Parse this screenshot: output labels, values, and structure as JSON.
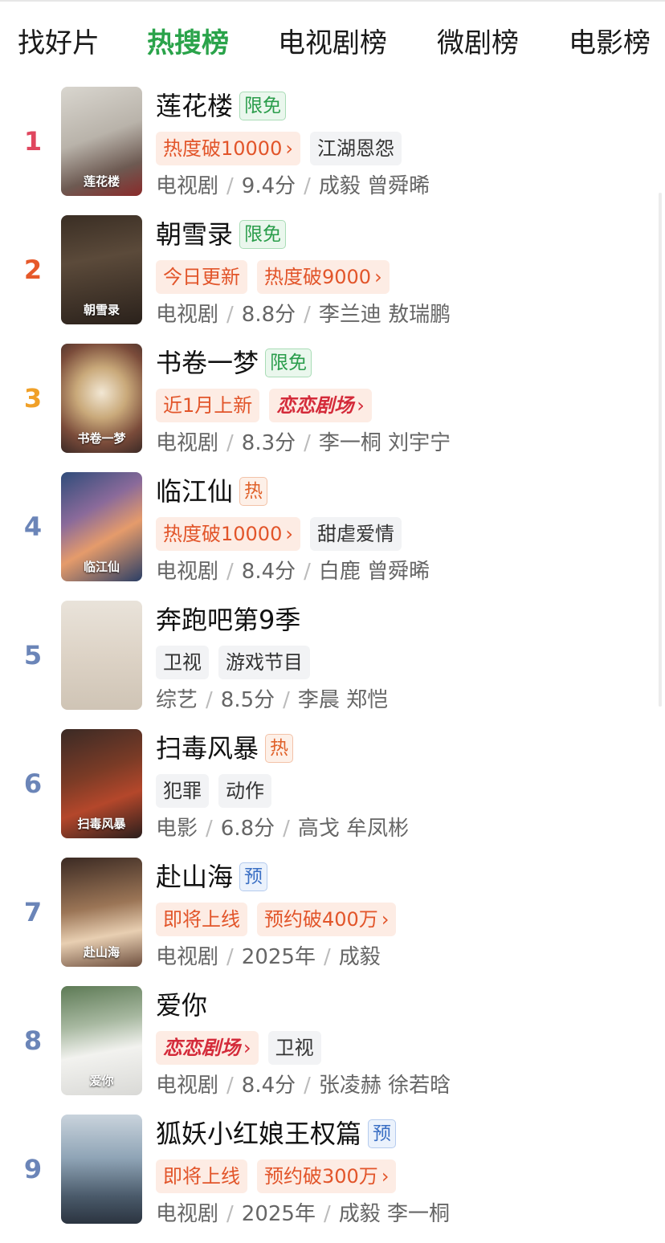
{
  "tabs": [
    {
      "label": "找好片",
      "active": false
    },
    {
      "label": "热搜榜",
      "active": true
    },
    {
      "label": "电视剧榜",
      "active": false
    },
    {
      "label": "微剧榜",
      "active": false
    },
    {
      "label": "电影榜",
      "active": false
    }
  ],
  "colors": {
    "active_tab": "#2aa34a",
    "rank_1": "#e0475f",
    "rank_2": "#e6592a",
    "rank_3": "#f0a028",
    "rank_other": "#6b85b8"
  },
  "items": [
    {
      "rank": "1",
      "title": "莲花楼",
      "badge": "限免",
      "badge_type": "free",
      "tags": [
        {
          "text": "热度破10000",
          "style": "orange",
          "chevron": "›"
        },
        {
          "text": "江湖恩怨",
          "style": "gray"
        }
      ],
      "meta": {
        "type": "电视剧",
        "score": "9.4分",
        "cast": "成毅 曾舜晞"
      },
      "poster": {
        "icon": "poster-image",
        "caption": "莲花楼"
      }
    },
    {
      "rank": "2",
      "title": "朝雪录",
      "badge": "限免",
      "badge_type": "free",
      "tags": [
        {
          "text": "今日更新",
          "style": "orange"
        },
        {
          "text": "热度破9000",
          "style": "orange",
          "chevron": "›"
        }
      ],
      "meta": {
        "type": "电视剧",
        "score": "8.8分",
        "cast": "李兰迪 敖瑞鹏"
      },
      "poster": {
        "icon": "poster-image",
        "caption": "朝雪录"
      }
    },
    {
      "rank": "3",
      "title": "书卷一梦",
      "badge": "限免",
      "badge_type": "free",
      "tags": [
        {
          "text": "近1月上新",
          "style": "orange"
        },
        {
          "text": "恋恋剧场",
          "style": "brand",
          "chevron": "›"
        }
      ],
      "meta": {
        "type": "电视剧",
        "score": "8.3分",
        "cast": "李一桐 刘宇宁"
      },
      "poster": {
        "icon": "poster-image",
        "caption": "书卷一梦"
      }
    },
    {
      "rank": "4",
      "title": "临江仙",
      "badge": "热",
      "badge_type": "hot",
      "tags": [
        {
          "text": "热度破10000",
          "style": "orange",
          "chevron": "›"
        },
        {
          "text": "甜虐爱情",
          "style": "gray"
        }
      ],
      "meta": {
        "type": "电视剧",
        "score": "8.4分",
        "cast": "白鹿 曾舜晞"
      },
      "poster": {
        "icon": "poster-image",
        "caption": "临江仙"
      }
    },
    {
      "rank": "5",
      "title": "奔跑吧第9季",
      "badge": "",
      "badge_type": "",
      "tags": [
        {
          "text": "卫视",
          "style": "gray"
        },
        {
          "text": "游戏节目",
          "style": "gray"
        }
      ],
      "meta": {
        "type": "综艺",
        "score": "8.5分",
        "cast": "李晨 郑恺"
      },
      "poster": {
        "icon": "poster-image",
        "caption": ""
      }
    },
    {
      "rank": "6",
      "title": "扫毒风暴",
      "badge": "热",
      "badge_type": "hot",
      "tags": [
        {
          "text": "犯罪",
          "style": "gray"
        },
        {
          "text": "动作",
          "style": "gray"
        }
      ],
      "meta": {
        "type": "电影",
        "score": "6.8分",
        "cast": "高戈 牟凤彬"
      },
      "poster": {
        "icon": "poster-image",
        "caption": "扫毒风暴"
      }
    },
    {
      "rank": "7",
      "title": "赴山海",
      "badge": "预",
      "badge_type": "pre",
      "tags": [
        {
          "text": "即将上线",
          "style": "orange"
        },
        {
          "text": "预约破400万",
          "style": "orange",
          "chevron": "›"
        }
      ],
      "meta": {
        "type": "电视剧",
        "score": "2025年",
        "cast": "成毅"
      },
      "poster": {
        "icon": "poster-image",
        "caption": "赴山海"
      }
    },
    {
      "rank": "8",
      "title": "爱你",
      "badge": "",
      "badge_type": "",
      "tags": [
        {
          "text": "恋恋剧场",
          "style": "brand",
          "chevron": "›"
        },
        {
          "text": "卫视",
          "style": "gray"
        }
      ],
      "meta": {
        "type": "电视剧",
        "score": "8.4分",
        "cast": "张凌赫 徐若晗"
      },
      "poster": {
        "icon": "poster-image",
        "caption": "爱你"
      }
    },
    {
      "rank": "9",
      "title": "狐妖小红娘王权篇",
      "badge": "预",
      "badge_type": "pre",
      "tags": [
        {
          "text": "即将上线",
          "style": "orange"
        },
        {
          "text": "预约破300万",
          "style": "orange",
          "chevron": "›"
        }
      ],
      "meta": {
        "type": "电视剧",
        "score": "2025年",
        "cast": "成毅 李一桐"
      },
      "poster": {
        "icon": "poster-image",
        "caption": ""
      }
    }
  ]
}
